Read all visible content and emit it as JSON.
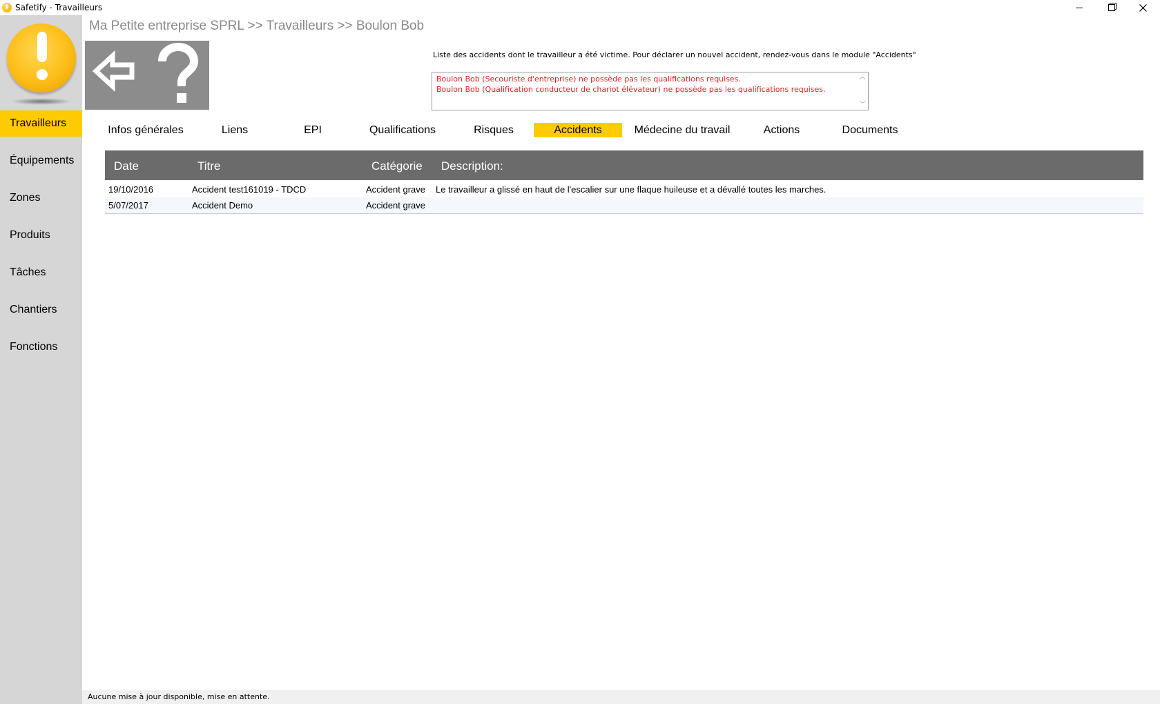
{
  "window": {
    "title": "Safetify - Travailleurs",
    "minimize_label": "—",
    "close_label": "✕"
  },
  "sidebar": {
    "items": [
      {
        "label": "Travailleurs",
        "active": true
      },
      {
        "label": "Équipements",
        "active": false
      },
      {
        "label": "Zones",
        "active": false
      },
      {
        "label": "Produits",
        "active": false
      },
      {
        "label": "Tâches",
        "active": false
      },
      {
        "label": "Chantiers",
        "active": false
      },
      {
        "label": "Fonctions",
        "active": false
      }
    ]
  },
  "breadcrumb": "Ma Petite entreprise SPRL >> Travailleurs >> Boulon Bob",
  "toolbar": {
    "back_icon": "arrow-left-icon",
    "help_icon": "question-icon",
    "help_label": "?"
  },
  "info_text": "Liste des accidents dont le travailleur a été victime. Pour déclarer un nouvel accident, rendez-vous dans le module \"Accidents\"",
  "warnings": [
    "Boulon Bob (Secouriste d'entreprise) ne possède pas les qualifications requises.",
    "Boulon Bob (Qualification conducteur de chariot élévateur) ne possède pas les qualifications requises."
  ],
  "tabs": [
    {
      "label": "Infos générales",
      "active": false
    },
    {
      "label": "Liens",
      "active": false
    },
    {
      "label": "EPI",
      "active": false
    },
    {
      "label": "Qualifications",
      "active": false
    },
    {
      "label": "Risques",
      "active": false
    },
    {
      "label": "Accidents",
      "active": true
    },
    {
      "label": "Médecine du travail",
      "active": false
    },
    {
      "label": "Actions",
      "active": false
    },
    {
      "label": "Documents",
      "active": false
    }
  ],
  "table": {
    "headers": [
      "Date",
      "Titre",
      "Catégorie",
      "Description:"
    ],
    "rows": [
      {
        "date": "19/10/2016",
        "titre": "Accident test161019 - TDCD",
        "categorie": "Accident grave",
        "description": "Le travailleur a glissé en haut de l'escalier sur une flaque huileuse et a dévallé toutes les marches."
      },
      {
        "date": "5/07/2017",
        "titre": "Accident Demo",
        "categorie": "Accident grave",
        "description": ""
      }
    ]
  },
  "status": "Aucune mise à jour disponible, mise en attente.",
  "colors": {
    "accent": "#fecb00",
    "sidebar_bg": "#d6d6d6",
    "header_bg": "#6b6b6b",
    "warning_text": "#e02020",
    "breadcrumb_text": "#8a8a8a"
  }
}
